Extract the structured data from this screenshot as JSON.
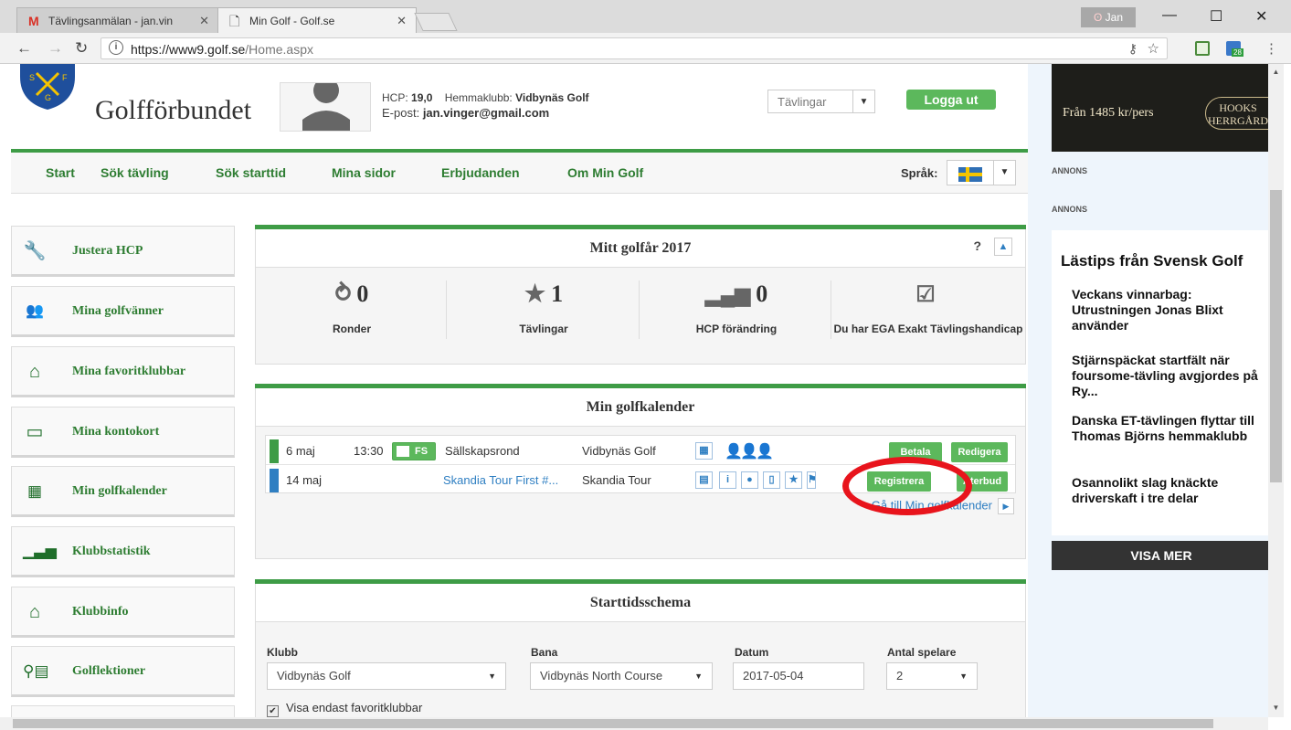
{
  "browser": {
    "tabs": [
      {
        "label": "Tävlingsanmälan - jan.vin",
        "icon": "gmail-icon",
        "color": "#d93025"
      },
      {
        "label": "Min Golf - Golf.se",
        "icon": "page-icon"
      }
    ],
    "profile_badge": "Jan",
    "url_host": "https://www9.golf.se",
    "url_path": "/Home.aspx",
    "ext_badge": "28"
  },
  "header": {
    "logo_text": "Golfförbundet",
    "hcp_label": "HCP:",
    "hcp_value": "19,0",
    "club_label": "Hemmaklubb:",
    "club_value": "Vidbynäs Golf",
    "email_label": "E-post:",
    "email_value": "jan.vinger@gmail.com",
    "select_value": "Tävlingar",
    "logout_label": "Logga ut"
  },
  "nav": {
    "items": [
      "Start",
      "Sök tävling",
      "Sök starttid",
      "Mina sidor",
      "Erbjudanden",
      "Om Min Golf"
    ],
    "lang_label": "Språk:"
  },
  "sidebar": {
    "items": [
      {
        "label": "Justera HCP",
        "icon": "wrench-icon"
      },
      {
        "label": "Mina golfvänner",
        "icon": "group-icon"
      },
      {
        "label": "Mina favoritklubbar",
        "icon": "house-star-icon"
      },
      {
        "label": "Mina kontokort",
        "icon": "card-icon"
      },
      {
        "label": "Min golfkalender",
        "icon": "calendar-icon"
      },
      {
        "label": "Klubbstatistik",
        "icon": "bar-chart-icon"
      },
      {
        "label": "Klubbinfo",
        "icon": "house-star-icon"
      },
      {
        "label": "Golflektioner",
        "icon": "search-list-icon"
      }
    ]
  },
  "golfyear": {
    "title": "Mitt golfår 2017",
    "help": "?",
    "stats": [
      {
        "value": "0",
        "label": "Ronder",
        "icon": "golf-swing-icon"
      },
      {
        "value": "1",
        "label": "Tävlingar",
        "icon": "star-icon"
      },
      {
        "value": "0",
        "label": "HCP förändring",
        "icon": "bar-chart-icon"
      },
      {
        "value": "",
        "label": "Du har EGA Exakt Tävlingshandicap",
        "icon": "checkbox-icon"
      }
    ]
  },
  "calendar": {
    "title": "Min golfkalender",
    "rows": [
      {
        "date": "6 maj",
        "time": "13:30",
        "badge": "FS",
        "event": "Sällskapsrond",
        "club": "Vidbynäs Golf",
        "btn1": "Betala",
        "btn2": "Redigera",
        "stripe": "#3e9c46"
      },
      {
        "date": "14 maj",
        "time": "",
        "badge": "",
        "event": "Skandia Tour First #...",
        "club": "Skandia Tour",
        "btn1": "Registrera",
        "btn2": "Återbud",
        "stripe": "#2f7fc2"
      }
    ],
    "goto_label": "Gå till Min golfkalender"
  },
  "starttid": {
    "title": "Starttidsschema",
    "fields": [
      {
        "label": "Klubb",
        "value": "Vidbynäs Golf"
      },
      {
        "label": "Bana",
        "value": "Vidbynäs North Course"
      },
      {
        "label": "Datum",
        "value": "2017-05-04"
      },
      {
        "label": "Antal spelare",
        "value": "2"
      }
    ],
    "checkbox_label": "Visa endast favoritklubbar"
  },
  "ads": {
    "banner_price": "Från 1485 kr/pers",
    "banner_brand": "HOOKS HERRGÅRD",
    "annons": "ANNONS",
    "tips_title": "Lästips från Svensk Golf",
    "tips": [
      "Veckans vinnarbag: Utrustningen Jonas Blixt använder",
      "Stjärnspäckat startfält när foursome-tävling avgjordes på Ry...",
      "Danska ET-tävlingen flyttar till Thomas Björns hemmaklubb",
      "Osannolikt slag knäckte driverskaft i tre delar"
    ],
    "visa_mer": "VISA MER"
  },
  "colors": {
    "brand_green": "#3e9c46",
    "button_green": "#5cb85c",
    "link_blue": "#2f7fc2",
    "annotation_red": "#e8141c"
  }
}
